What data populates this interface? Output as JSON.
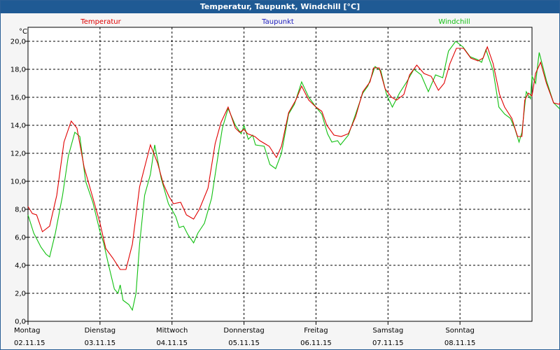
{
  "window": {
    "title": "Temperatur, Taupunkt, Windchill [°C]"
  },
  "colors": {
    "temperatur": "#e00000",
    "taupunkt": "#2020c0",
    "windchill": "#10c010",
    "title_bar": "#1f5a94"
  },
  "chart_data": {
    "type": "line",
    "title": "Temperatur, Taupunkt, Windchill [°C]",
    "ylabel": "°C",
    "ylim": [
      0,
      21
    ],
    "yticks": [
      "0,0",
      "2,0",
      "4,0",
      "6,0",
      "8,0",
      "10,0",
      "12,0",
      "14,0",
      "16,0",
      "18,0",
      "20,0"
    ],
    "ytick_values": [
      0,
      2,
      4,
      6,
      8,
      10,
      12,
      14,
      16,
      18,
      20
    ],
    "xlim": [
      0,
      7
    ],
    "x_days": [
      {
        "day": "Montag",
        "date": "02.11.15",
        "x": 0
      },
      {
        "day": "Dienstag",
        "date": "03.11.15",
        "x": 1
      },
      {
        "day": "Mittwoch",
        "date": "04.11.15",
        "x": 2
      },
      {
        "day": "Donnerstag",
        "date": "05.11.15",
        "x": 3
      },
      {
        "day": "Freitag",
        "date": "06.11.15",
        "x": 4
      },
      {
        "day": "Samstag",
        "date": "07.11.15",
        "x": 5
      },
      {
        "day": "Sonntag",
        "date": "08.11.15",
        "x": 6
      }
    ],
    "grid": true,
    "legend": [
      "Temperatur",
      "Taupunkt",
      "Windchill"
    ],
    "series": [
      {
        "name": "Temperatur",
        "points": [
          [
            0,
            8.2
          ],
          [
            0.06,
            7.7
          ],
          [
            0.12,
            7.6
          ],
          [
            0.2,
            6.4
          ],
          [
            0.3,
            6.8
          ],
          [
            0.4,
            9.0
          ],
          [
            0.5,
            12.8
          ],
          [
            0.6,
            14.3
          ],
          [
            0.68,
            13.8
          ],
          [
            0.78,
            11.0
          ],
          [
            0.88,
            9.2
          ],
          [
            1.0,
            7.0
          ],
          [
            1.08,
            5.2
          ],
          [
            1.18,
            4.5
          ],
          [
            1.28,
            3.7
          ],
          [
            1.36,
            3.7
          ],
          [
            1.45,
            5.5
          ],
          [
            1.55,
            9.6
          ],
          [
            1.62,
            11.0
          ],
          [
            1.7,
            12.6
          ],
          [
            1.8,
            11.3
          ],
          [
            1.88,
            9.8
          ],
          [
            1.96,
            8.9
          ],
          [
            2.02,
            8.4
          ],
          [
            2.12,
            8.5
          ],
          [
            2.2,
            7.6
          ],
          [
            2.3,
            7.3
          ],
          [
            2.38,
            8.0
          ],
          [
            2.5,
            9.5
          ],
          [
            2.6,
            12.7
          ],
          [
            2.68,
            14.2
          ],
          [
            2.78,
            15.3
          ],
          [
            2.88,
            13.8
          ],
          [
            2.94,
            13.5
          ],
          [
            3.0,
            13.7
          ],
          [
            3.05,
            13.4
          ],
          [
            3.15,
            13.2
          ],
          [
            3.22,
            12.9
          ],
          [
            3.35,
            12.5
          ],
          [
            3.45,
            11.7
          ],
          [
            3.52,
            12.5
          ],
          [
            3.62,
            14.9
          ],
          [
            3.72,
            15.8
          ],
          [
            3.8,
            16.8
          ],
          [
            3.9,
            15.8
          ],
          [
            4.0,
            15.3
          ],
          [
            4.08,
            15.0
          ],
          [
            4.15,
            14.0
          ],
          [
            4.25,
            13.3
          ],
          [
            4.35,
            13.2
          ],
          [
            4.45,
            13.4
          ],
          [
            4.55,
            14.6
          ],
          [
            4.65,
            16.4
          ],
          [
            4.75,
            17.1
          ],
          [
            4.8,
            18.1
          ],
          [
            4.88,
            18.1
          ],
          [
            4.96,
            16.6
          ],
          [
            5.05,
            16.0
          ],
          [
            5.12,
            15.8
          ],
          [
            5.22,
            16.2
          ],
          [
            5.3,
            17.6
          ],
          [
            5.4,
            18.3
          ],
          [
            5.5,
            17.7
          ],
          [
            5.6,
            17.5
          ],
          [
            5.7,
            16.5
          ],
          [
            5.78,
            17.0
          ],
          [
            5.86,
            18.4
          ],
          [
            5.95,
            19.5
          ],
          [
            6.05,
            19.5
          ],
          [
            6.15,
            18.8
          ],
          [
            6.25,
            18.6
          ],
          [
            6.32,
            18.8
          ],
          [
            6.38,
            19.6
          ],
          [
            6.46,
            18.4
          ],
          [
            6.55,
            16.2
          ],
          [
            6.62,
            15.3
          ],
          [
            6.72,
            14.5
          ],
          [
            6.8,
            13.2
          ],
          [
            6.86,
            13.2
          ],
          [
            6.9,
            15.8
          ],
          [
            6.95,
            16.3
          ],
          [
            7.0,
            16.1
          ],
          [
            7.05,
            17.7
          ],
          [
            7.12,
            18.5
          ],
          [
            7.2,
            17.0
          ],
          [
            7.3,
            15.6
          ],
          [
            7.38,
            15.5
          ],
          [
            7.42,
            16.0
          ],
          [
            7.46,
            17.6
          ]
        ]
      },
      {
        "name": "Windchill",
        "points": [
          [
            0,
            7.6
          ],
          [
            0.08,
            6.3
          ],
          [
            0.18,
            5.3
          ],
          [
            0.25,
            4.8
          ],
          [
            0.3,
            4.6
          ],
          [
            0.38,
            6.3
          ],
          [
            0.48,
            9.0
          ],
          [
            0.56,
            11.8
          ],
          [
            0.65,
            13.5
          ],
          [
            0.72,
            13.2
          ],
          [
            0.8,
            10.0
          ],
          [
            0.9,
            8.5
          ],
          [
            1.0,
            6.4
          ],
          [
            1.05,
            5.6
          ],
          [
            1.12,
            4.0
          ],
          [
            1.2,
            2.3
          ],
          [
            1.25,
            2.0
          ],
          [
            1.28,
            2.6
          ],
          [
            1.32,
            1.5
          ],
          [
            1.4,
            1.2
          ],
          [
            1.45,
            0.8
          ],
          [
            1.5,
            2.0
          ],
          [
            1.55,
            5.5
          ],
          [
            1.62,
            9.0
          ],
          [
            1.7,
            10.5
          ],
          [
            1.76,
            12.6
          ],
          [
            1.85,
            10.2
          ],
          [
            1.95,
            8.4
          ],
          [
            2.05,
            7.5
          ],
          [
            2.1,
            6.7
          ],
          [
            2.16,
            6.8
          ],
          [
            2.22,
            6.2
          ],
          [
            2.3,
            5.6
          ],
          [
            2.36,
            6.3
          ],
          [
            2.45,
            7.0
          ],
          [
            2.55,
            8.8
          ],
          [
            2.65,
            12.2
          ],
          [
            2.7,
            13.8
          ],
          [
            2.78,
            15.2
          ],
          [
            2.88,
            14.0
          ],
          [
            2.96,
            13.4
          ],
          [
            3.0,
            14.0
          ],
          [
            3.06,
            13.0
          ],
          [
            3.12,
            13.3
          ],
          [
            3.16,
            12.6
          ],
          [
            3.28,
            12.5
          ],
          [
            3.36,
            11.2
          ],
          [
            3.44,
            10.9
          ],
          [
            3.52,
            12.0
          ],
          [
            3.62,
            14.8
          ],
          [
            3.7,
            15.5
          ],
          [
            3.8,
            17.1
          ],
          [
            3.9,
            16.0
          ],
          [
            4.0,
            15.3
          ],
          [
            4.08,
            14.8
          ],
          [
            4.16,
            13.4
          ],
          [
            4.22,
            12.8
          ],
          [
            4.3,
            12.9
          ],
          [
            4.34,
            12.6
          ],
          [
            4.45,
            13.3
          ],
          [
            4.55,
            14.8
          ],
          [
            4.65,
            16.3
          ],
          [
            4.72,
            16.8
          ],
          [
            4.78,
            17.6
          ],
          [
            4.82,
            18.2
          ],
          [
            4.9,
            17.9
          ],
          [
            4.98,
            16.2
          ],
          [
            5.06,
            15.3
          ],
          [
            5.16,
            16.3
          ],
          [
            5.26,
            17.1
          ],
          [
            5.36,
            18.0
          ],
          [
            5.46,
            17.6
          ],
          [
            5.56,
            16.4
          ],
          [
            5.66,
            17.6
          ],
          [
            5.76,
            17.4
          ],
          [
            5.84,
            19.3
          ],
          [
            5.94,
            20.0
          ],
          [
            6.04,
            19.6
          ],
          [
            6.14,
            18.9
          ],
          [
            6.24,
            18.7
          ],
          [
            6.3,
            18.5
          ],
          [
            6.36,
            19.4
          ],
          [
            6.46,
            17.9
          ],
          [
            6.54,
            15.3
          ],
          [
            6.62,
            14.8
          ],
          [
            6.7,
            14.5
          ],
          [
            6.76,
            13.8
          ],
          [
            6.82,
            12.8
          ],
          [
            6.86,
            13.5
          ],
          [
            6.92,
            16.4
          ],
          [
            6.98,
            15.9
          ],
          [
            7.0,
            17.5
          ],
          [
            7.05,
            17.0
          ],
          [
            7.1,
            19.2
          ],
          [
            7.2,
            17.2
          ],
          [
            7.3,
            15.6
          ],
          [
            7.4,
            15.1
          ],
          [
            7.46,
            16.2
          ]
        ]
      }
    ]
  }
}
